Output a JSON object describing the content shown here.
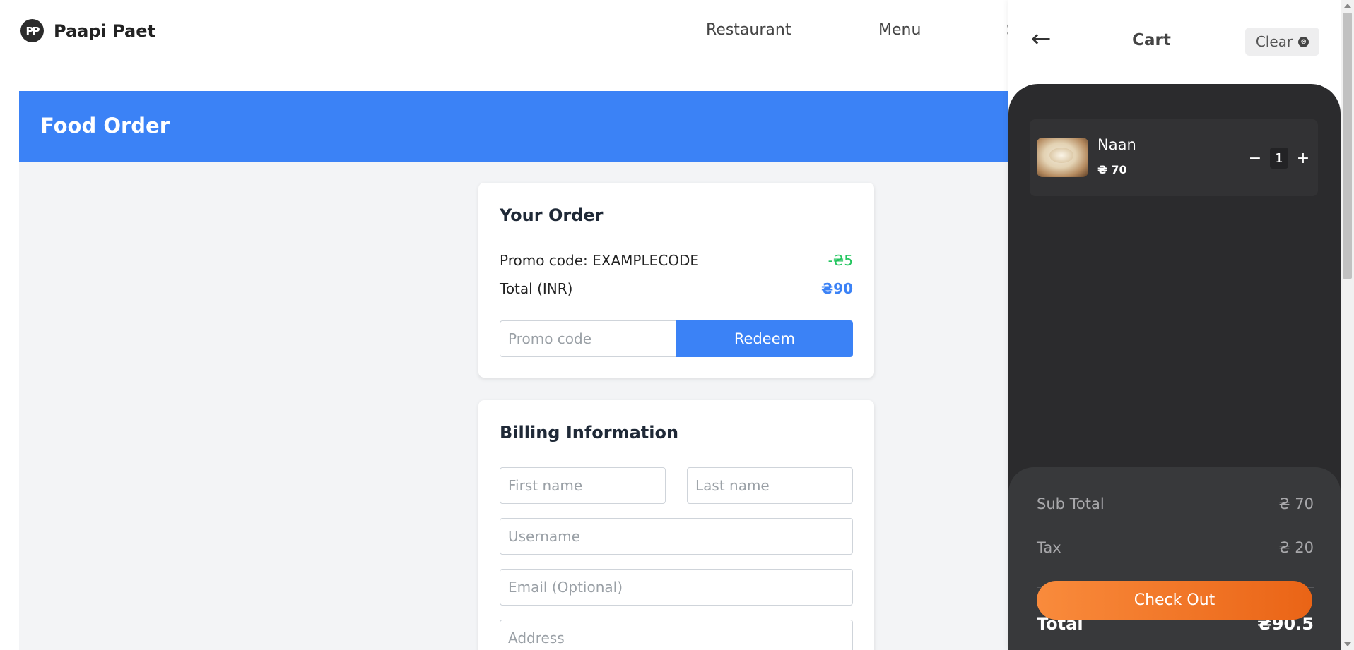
{
  "brand": {
    "logo_text": "PP",
    "name": "Paapi Paet"
  },
  "nav": {
    "links": [
      "Restaurant",
      "Menu",
      "S"
    ]
  },
  "banner": {
    "title": "Food Order"
  },
  "order": {
    "title": "Your Order",
    "promo_label": "Promo code: EXAMPLECODE",
    "promo_value": "-₴5",
    "total_label": "Total (INR)",
    "total_value": "₴90",
    "promo_placeholder": "Promo code",
    "redeem_label": "Redeem"
  },
  "billing": {
    "title": "Billing Information",
    "first_name_placeholder": "First name",
    "last_name_placeholder": "Last name",
    "username_placeholder": "Username",
    "email_placeholder": "Email (Optional)",
    "address_placeholder": "Address"
  },
  "cart": {
    "back_icon": "←",
    "title": "Cart",
    "clear_label": "Clear",
    "clear_icon": "⊗",
    "items": [
      {
        "name": "Naan",
        "price": "₴ 70",
        "qty": "1",
        "minus": "−",
        "plus": "+"
      }
    ],
    "subtotal_label": "Sub Total",
    "subtotal_value": "₴ 70",
    "tax_label": "Tax",
    "tax_value": "₴ 20",
    "total_label": "Total",
    "total_value": "₴90.5",
    "checkout_label": "Check Out"
  },
  "colors": {
    "accent": "#3b82f6",
    "promo_green": "#22c55e",
    "checkout_orange": "#f97316",
    "cart_dark": "#2b2b2d"
  }
}
